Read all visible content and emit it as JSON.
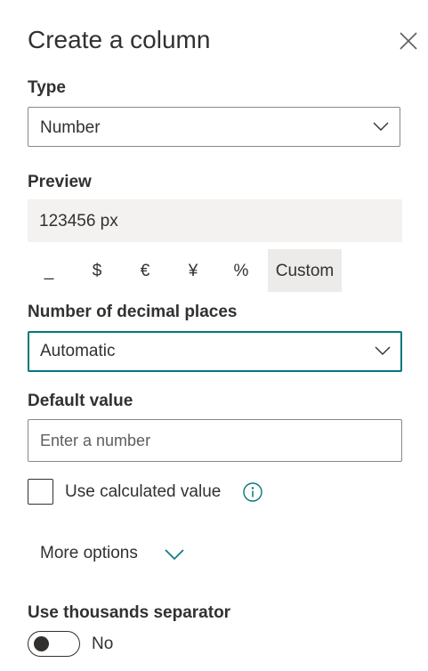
{
  "panel": {
    "title": "Create a column"
  },
  "type_field": {
    "label": "Type",
    "value": "Number"
  },
  "preview": {
    "label": "Preview",
    "value": "123456 px"
  },
  "format_options": {
    "none": "_",
    "dollar": "$",
    "euro": "€",
    "yen": "¥",
    "percent": "%",
    "custom": "Custom",
    "selected": "Custom"
  },
  "decimal_places": {
    "label": "Number of decimal places",
    "value": "Automatic"
  },
  "default_value": {
    "label": "Default value",
    "placeholder": "Enter a number",
    "value": ""
  },
  "calculated": {
    "label": "Use calculated value",
    "checked": false
  },
  "more_options": {
    "label": "More options"
  },
  "thousands_separator": {
    "label": "Use thousands separator",
    "state_label": "No",
    "on": false
  },
  "icons": {
    "close": "close-icon",
    "chevron": "chevron-down-icon",
    "info": "info-icon"
  },
  "colors": {
    "accent": "#03787c",
    "text": "#323130",
    "border": "#8a8886",
    "preview_bg": "#f3f2f1",
    "selected_bg": "#edebe9"
  }
}
